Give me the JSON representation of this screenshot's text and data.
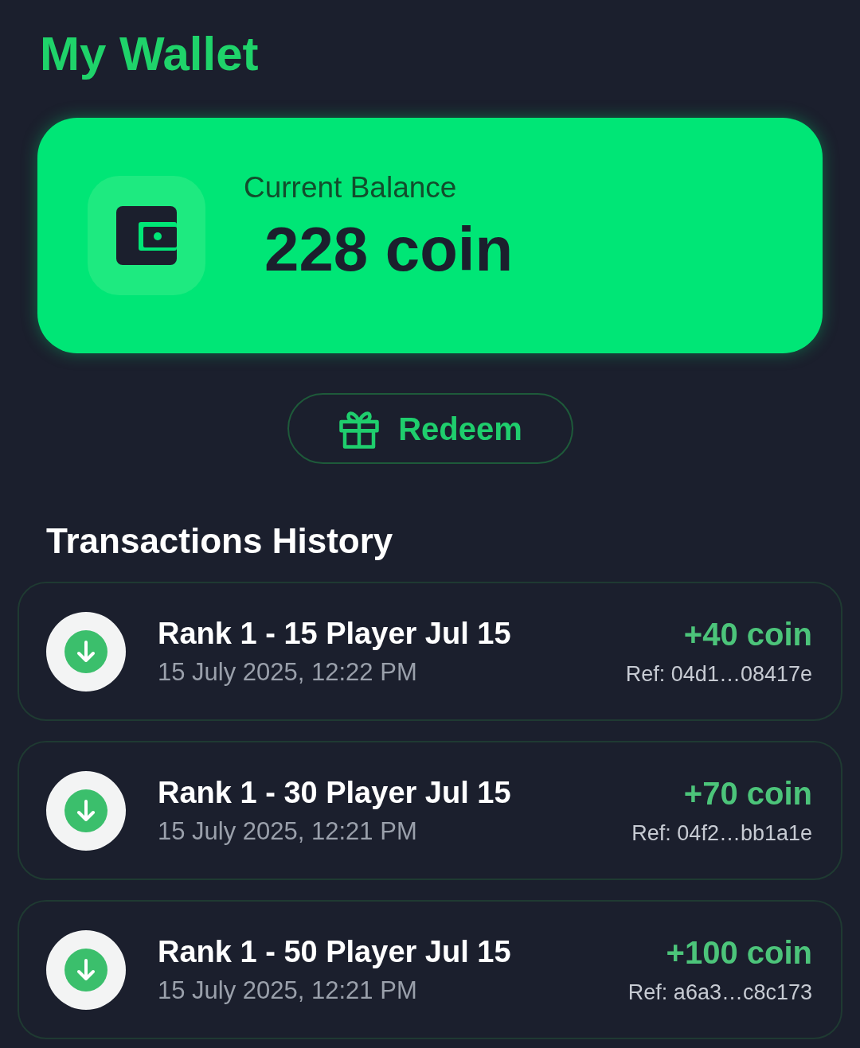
{
  "title": "My Wallet",
  "balance": {
    "label": "Current Balance",
    "amount": "228 coin"
  },
  "redeem_button": {
    "label": "Redeem"
  },
  "history": {
    "heading": "Transactions History",
    "transactions": [
      {
        "kind": "credit",
        "title": "Rank 1 - 15 Player Jul 15",
        "date": "15 July 2025, 12:22 PM",
        "amount": "+40 coin",
        "ref": "Ref: 04d1…08417e"
      },
      {
        "kind": "credit",
        "title": "Rank 1 - 30 Player Jul 15",
        "date": "15 July 2025, 12:21 PM",
        "amount": "+70 coin",
        "ref": "Ref: 04f2…bb1a1e"
      },
      {
        "kind": "credit",
        "title": "Rank 1 - 50 Player Jul 15",
        "date": "15 July 2025, 12:21 PM",
        "amount": "+100 coin",
        "ref": "Ref: a6a3…c8c173"
      }
    ]
  }
}
